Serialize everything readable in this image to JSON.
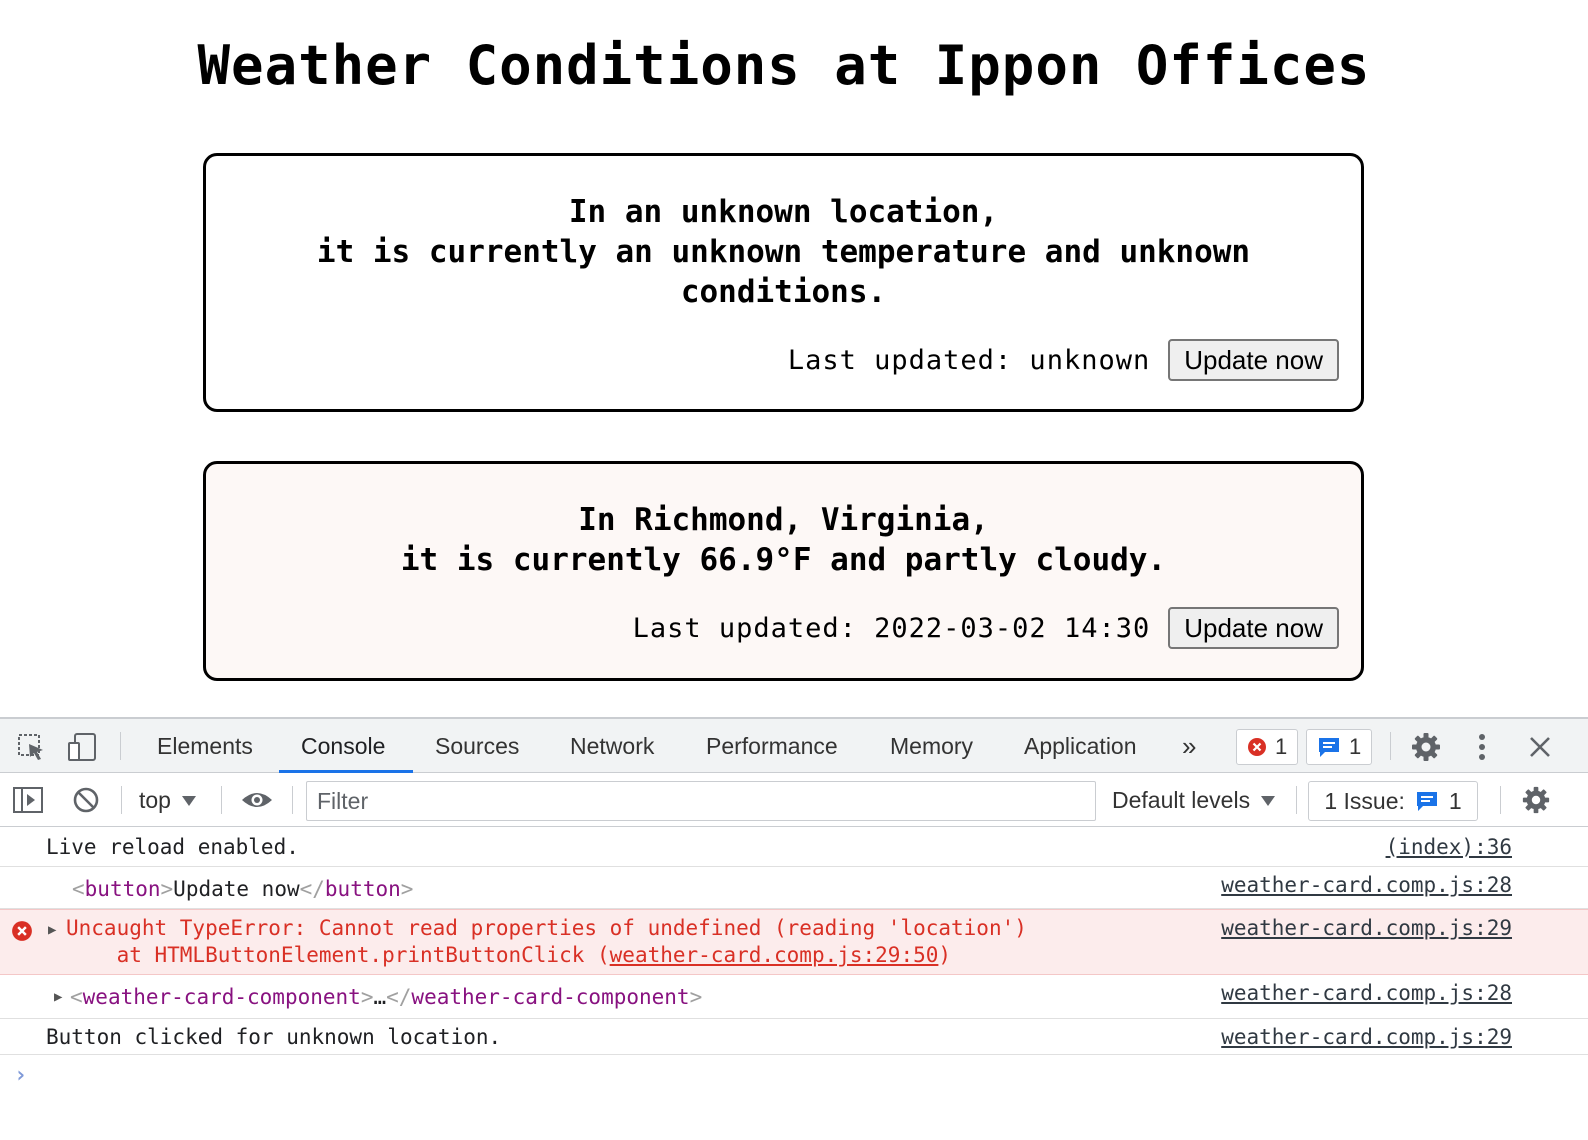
{
  "page": {
    "title": "Weather Conditions at Ippon Offices"
  },
  "cards": [
    {
      "line1": "In an unknown location,",
      "line2": "it is currently an unknown temperature and unknown conditions.",
      "last_updated": "Last updated: unknown",
      "button_label": "Update now"
    },
    {
      "line1": "In Richmond, Virginia,",
      "line2": "it is currently 66.9°F and partly cloudy.",
      "last_updated": "Last updated: 2022-03-02 14:30",
      "button_label": "Update now"
    }
  ],
  "devtools": {
    "tabs": [
      "Elements",
      "Console",
      "Sources",
      "Network",
      "Performance",
      "Memory",
      "Application"
    ],
    "active_tab": "Console",
    "more_tabs_icon": "»",
    "error_count": "1",
    "message_count": "1",
    "toolbar": {
      "context": "top",
      "filter_placeholder": "Filter",
      "levels": "Default levels",
      "issues_label": "1 Issue:",
      "issues_count": "1"
    },
    "console": {
      "row1": {
        "text": "Live reload enabled.",
        "source": "(index):36"
      },
      "row2": {
        "tag_open": "button",
        "text": "Update now",
        "tag_close": "button",
        "source": "weather-card.comp.js:28"
      },
      "row3": {
        "line1": "Uncaught TypeError: Cannot read properties of undefined (reading 'location')",
        "line2_prefix": "    at HTMLButtonElement.printButtonClick (",
        "line2_link": "weather-card.comp.js:29:50",
        "line2_suffix": ")",
        "source": "weather-card.comp.js:29"
      },
      "row4": {
        "tag_open": "weather-card-component",
        "ellipsis": "…",
        "tag_close": "weather-card-component",
        "source": "weather-card.comp.js:28"
      },
      "row5": {
        "text": "Button clicked for unknown location.",
        "source": "weather-card.comp.js:29"
      },
      "prompt": "›"
    }
  },
  "colors": {
    "error_red": "#d93025",
    "tag_purple": "#881280",
    "accent_blue": "#1a73e8",
    "card2_bg": "#fdf8f6"
  },
  "icons": [
    "inspect-element-icon",
    "device-toggle-icon",
    "more-tabs-icon",
    "error-icon",
    "message-icon",
    "settings-icon",
    "kebab-menu-icon",
    "close-icon",
    "sidebar-toggle-icon",
    "clear-console-icon",
    "dropdown-arrow-icon",
    "eye-icon",
    "console-settings-icon",
    "expand-triangle-icon"
  ]
}
